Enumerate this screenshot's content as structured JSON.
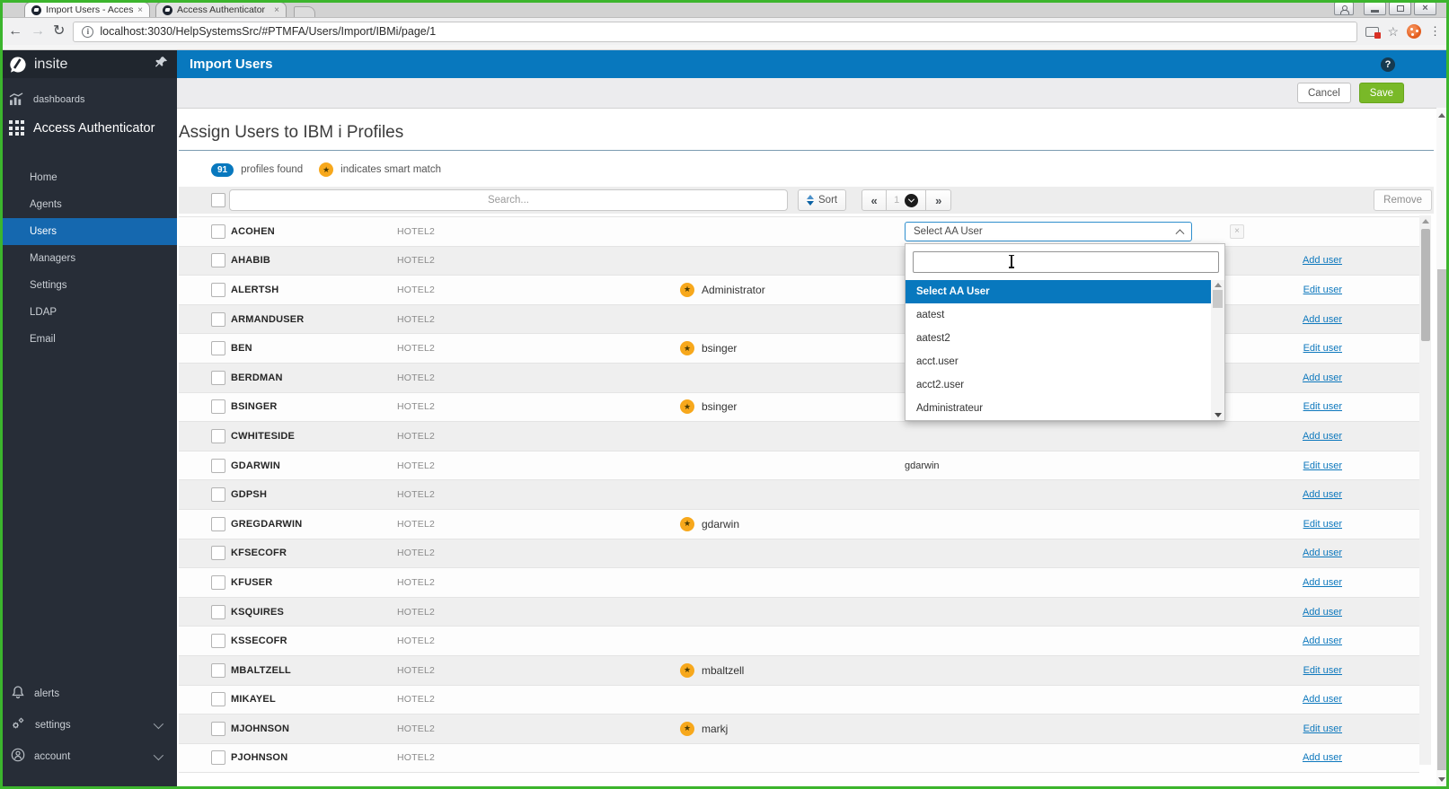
{
  "browser": {
    "tabs": [
      {
        "title": "Import Users - Access Au",
        "active": true
      },
      {
        "title": "Access Authenticator",
        "active": false
      }
    ],
    "url": "localhost:3030/HelpSystemsSrc/#PTMFA/Users/Import/IBMi/page/1"
  },
  "sidebar": {
    "brand": "insite",
    "dashboards_label": "dashboards",
    "product_label": "Access Authenticator",
    "nav": [
      {
        "label": "Home",
        "active": false
      },
      {
        "label": "Agents",
        "active": false
      },
      {
        "label": "Users",
        "active": true
      },
      {
        "label": "Managers",
        "active": false
      },
      {
        "label": "Settings",
        "active": false
      },
      {
        "label": "LDAP",
        "active": false
      },
      {
        "label": "Email",
        "active": false
      }
    ],
    "bottom": [
      {
        "label": "alerts",
        "icon": "bell-icon",
        "expandable": false
      },
      {
        "label": "settings",
        "icon": "gear-icon",
        "expandable": true
      },
      {
        "label": "account",
        "icon": "account-icon",
        "expandable": true
      }
    ]
  },
  "header": {
    "title": "Import Users"
  },
  "action_bar": {
    "cancel": "Cancel",
    "save": "Save"
  },
  "page": {
    "heading": "Assign Users to IBM i Profiles",
    "count": "91",
    "count_label": "profiles found",
    "smart_label": "indicates smart match"
  },
  "list_toolbar": {
    "search_placeholder": "Search...",
    "sort": "Sort",
    "page": "1",
    "remove": "Remove"
  },
  "dropdown": {
    "value": "Select AA User",
    "search_value": "",
    "options": [
      {
        "label": "Select AA User",
        "selected": true
      },
      {
        "label": "aatest",
        "selected": false
      },
      {
        "label": "aatest2",
        "selected": false
      },
      {
        "label": "acct.user",
        "selected": false
      },
      {
        "label": "acct2.user",
        "selected": false
      },
      {
        "label": "Administrateur",
        "selected": false
      }
    ]
  },
  "table": {
    "rows": [
      {
        "profile": "ACOHEN",
        "system": "HOTEL2",
        "type": "select"
      },
      {
        "profile": "AHABIB",
        "system": "HOTEL2",
        "link": "Add user"
      },
      {
        "profile": "ALERTSH",
        "system": "HOTEL2",
        "smart_match": "Administrator",
        "link": "Edit user"
      },
      {
        "profile": "ARMANDUSER",
        "system": "HOTEL2",
        "link": "Add user"
      },
      {
        "profile": "BEN",
        "system": "HOTEL2",
        "smart_match": "bsinger",
        "link": "Edit user"
      },
      {
        "profile": "BERDMAN",
        "system": "HOTEL2",
        "link": "Add user"
      },
      {
        "profile": "BSINGER",
        "system": "HOTEL2",
        "smart_match": "bsinger",
        "link": "Edit user"
      },
      {
        "profile": "CWHITESIDE",
        "system": "HOTEL2",
        "link": "Add user"
      },
      {
        "profile": "GDARWIN",
        "system": "HOTEL2",
        "assigned": "gdarwin",
        "link": "Edit user"
      },
      {
        "profile": "GDPSH",
        "system": "HOTEL2",
        "link": "Add user"
      },
      {
        "profile": "GREGDARWIN",
        "system": "HOTEL2",
        "smart_match": "gdarwin",
        "link": "Edit user"
      },
      {
        "profile": "KFSECOFR",
        "system": "HOTEL2",
        "link": "Add user"
      },
      {
        "profile": "KFUSER",
        "system": "HOTEL2",
        "link": "Add user"
      },
      {
        "profile": "KSQUIRES",
        "system": "HOTEL2",
        "link": "Add user"
      },
      {
        "profile": "KSSECOFR",
        "system": "HOTEL2",
        "link": "Add user"
      },
      {
        "profile": "MBALTZELL",
        "system": "HOTEL2",
        "smart_match": "mbaltzell",
        "link": "Edit user"
      },
      {
        "profile": "MIKAYEL",
        "system": "HOTEL2",
        "link": "Add user"
      },
      {
        "profile": "MJOHNSON",
        "system": "HOTEL2",
        "smart_match": "markj",
        "link": "Edit user"
      },
      {
        "profile": "PJOHNSON",
        "system": "HOTEL2",
        "link": "Add user"
      }
    ]
  },
  "icons": {
    "smart_star": "★",
    "bookmark_star": "☆",
    "help": "?",
    "clear": "×",
    "tab_close": "×",
    "back": "←",
    "forward": "→",
    "reload": "↻",
    "info": "i",
    "kebab": "⋮",
    "window_close": "×"
  },
  "colors": {
    "accent_blue": "#0878be",
    "active_nav_blue": "#1568af",
    "save_green": "#79b928",
    "link_blue": "#0d78bd",
    "star_amber": "#f7a81c",
    "sidebar_bg": "#272d37",
    "row_stripe": "#efefef",
    "frame_green": "#3cb52d"
  }
}
